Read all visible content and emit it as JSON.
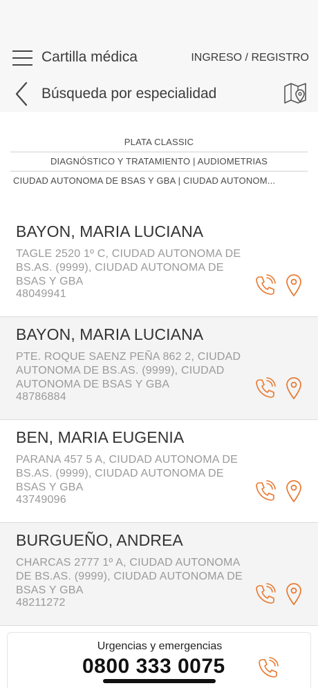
{
  "header": {
    "app_title": "Cartilla médica",
    "login_label": "INGRESO / REGISTRO",
    "menu_icon": "hamburger-menu-icon"
  },
  "subheader": {
    "page_title": "Búsqueda por especialidad",
    "back_icon": "chevron-left-icon",
    "map_icon": "map-pin-icon"
  },
  "filters": {
    "plan": "PLATA CLASSIC",
    "specialty": "DIAGNÓSTICO Y TRATAMIENTO | AUDIOMETRIAS",
    "location": "CIUDAD AUTONOMA DE BSAS Y GBA | CIUDAD AUTONOM..."
  },
  "results": [
    {
      "name": "BAYON, MARIA LUCIANA",
      "address": "TAGLE 2520 1º C, CIUDAD AUTONOMA DE BS.AS. (9999), CIUDAD AUTONOMA DE BSAS Y GBA",
      "phone": "48049941"
    },
    {
      "name": "BAYON, MARIA LUCIANA",
      "address": "PTE. ROQUE SAENZ PEÑA 862 2, CIUDAD AUTONOMA DE BS.AS. (9999), CIUDAD AUTONOMA DE BSAS Y GBA",
      "phone": "48786884"
    },
    {
      "name": "BEN, MARIA EUGENIA",
      "address": "PARANA 457 5 A, CIUDAD AUTONOMA DE BS.AS. (9999), CIUDAD AUTONOMA DE BSAS Y GBA",
      "phone": "43749096"
    },
    {
      "name": "BURGUEÑO, ANDREA",
      "address": "CHARCAS 2777 1º A, CIUDAD AUTONOMA DE BS.AS. (9999), CIUDAD AUTONOMA DE BSAS Y GBA",
      "phone": "48211272"
    }
  ],
  "emergency": {
    "label": "Urgencias y emergencias",
    "number": "0800 333 0075"
  },
  "colors": {
    "accent": "#e8772e",
    "text_primary": "#333333",
    "text_secondary": "#9a9a9a",
    "header_bg": "#f7f7f7",
    "alt_row_bg": "#f4f4f4"
  }
}
